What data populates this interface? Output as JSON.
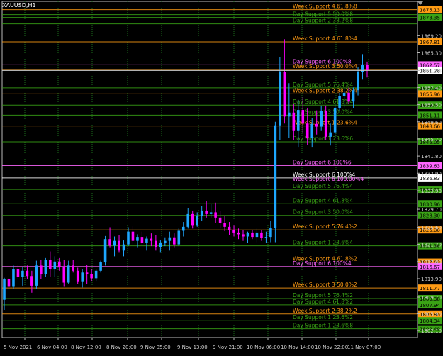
{
  "symbol_title": "XAUUSD,H1",
  "colors": {
    "bull": "#1ea7ff",
    "bear": "#ff00ff",
    "green_level": "#3aa315",
    "orange_level": "#ff9b14",
    "pink_level": "#ff66ff",
    "white_level": "#ffffff",
    "grid": "#1b6f1b"
  },
  "price_axis": {
    "min": 1800.5,
    "max": 1877.0,
    "ticks": [
      1869.2,
      1865.3,
      1861.28,
      1857.4,
      1853.5,
      1849.6,
      1845.7,
      1841.8,
      1837.9,
      1833.9,
      1829.7,
      1825.6,
      1821.7,
      1817.8,
      1813.9,
      1809.7,
      1805.9,
      1802.1
    ],
    "tick_labels": [
      "1869.20",
      "1865.30",
      "1861.28",
      "1857.40",
      "1853.50",
      "1849.60",
      "1845.70",
      "1841.80",
      "1837.90",
      "1833.90",
      "1829.70",
      "1825.60",
      "1821.70",
      "1817.80",
      "1813.90",
      "1809.70",
      "1805.90",
      "1802.10"
    ]
  },
  "time_axis": {
    "labels": [
      "5 Nov 2021",
      "6 Nov 04:00",
      "8 Nov 12:00",
      "8 Nov 20:00",
      "9 Nov 05:00",
      "9 Nov 13:00",
      "9 Nov 21:00",
      "10 Nov 06:00",
      "10 Nov 14:00",
      "10 Nov 22:00",
      "11 Nov 07:00"
    ]
  },
  "levels": [
    {
      "price": 1875.13,
      "label": "1875.13",
      "style": "orange",
      "text": "Week Support 4 61.8%8"
    },
    {
      "price": 1874.0,
      "label": "",
      "style": "green",
      "text": ""
    },
    {
      "price": 1873.35,
      "label": "1873.35",
      "style": "green",
      "text": "Day Support 5 50.0%8"
    },
    {
      "price": 1871.9,
      "label": "",
      "style": "green",
      "text": "Day Support 2 38.2%8"
    },
    {
      "price": 1867.81,
      "label": "1867.81",
      "style": "orange",
      "text": "Week Support 4 61.8%4"
    },
    {
      "price": 1862.57,
      "label": "1862.57",
      "style": "pink",
      "text": "Day Support 6 100%8"
    },
    {
      "price": 1861.5,
      "label": "",
      "style": "orange",
      "text": "Week Support 3 50.0%4"
    },
    {
      "price": 1857.34,
      "label": "1857.34",
      "style": "green",
      "text": "Day Support 5 76.4%4"
    },
    {
      "price": 1855.96,
      "label": "1855.96",
      "style": "orange",
      "text": "Week Support 2 38.2%4"
    },
    {
      "price": 1853.4,
      "label": "1853.4",
      "style": "green",
      "text": "Day Support 4 61.8%4"
    },
    {
      "price": 1851.11,
      "label": "1851.11",
      "style": "green",
      "text": "Day Support 3 50.0%4"
    },
    {
      "price": 1848.66,
      "label": "1848.66",
      "style": "orange",
      "text": "Week Support 1 23.6%4"
    },
    {
      "price": 1845.05,
      "label": "1845.05",
      "style": "green",
      "text": "Day Support 1 23.6%6"
    },
    {
      "price": 1839.63,
      "label": "1839.63",
      "style": "pink",
      "text": "Day Support 6 100%6"
    },
    {
      "price": 1836.83,
      "label": "1836.83",
      "style": "white",
      "text": "Week Support 6 100%4"
    },
    {
      "price": 1834.22,
      "label": "1834.22",
      "style": "green",
      "text": "Day Support 5 76.4%4"
    },
    {
      "price": 1830.96,
      "label": "1830.96",
      "style": "green",
      "text": "Day Support 4 61.8%4"
    },
    {
      "price": 1828.3,
      "label": "1828.30",
      "style": "green",
      "text": "Day Support 3 50.0%4"
    },
    {
      "price": 1825.0,
      "label": "1825.00",
      "style": "orange",
      "text": "Week Support 5 76.4%2"
    },
    {
      "price": 1821.38,
      "label": "1821.38",
      "style": "green",
      "text": "Day Support 1 23.6%4"
    },
    {
      "price": 1817.68,
      "label": "1817.68",
      "style": "orange",
      "text": "Week Support 4 61.8%2"
    },
    {
      "price": 1816.67,
      "label": "1816.67",
      "style": "pink",
      "text": "Day Support 6 100%4"
    },
    {
      "price": 1811.77,
      "label": "1811.77",
      "style": "orange",
      "text": "Week Support 3 50.0%2"
    },
    {
      "price": 1809.38,
      "label": "1809.38",
      "style": "green",
      "text": "Day Support 5 76.4%2"
    },
    {
      "price": 1807.94,
      "label": "1807.94",
      "style": "green",
      "text": "Day Support 4 61.8%2"
    },
    {
      "price": 1805.86,
      "label": "1805.86",
      "style": "orange",
      "text": "Week Support 2 38.2%2"
    },
    {
      "price": 1804.34,
      "label": "1804.34",
      "style": "green",
      "text": "Day Support 1 23.6%2"
    },
    {
      "price": 1802.49,
      "label": "1802.49",
      "style": "green",
      "text": "Day Support 1 23.6%8"
    }
  ],
  "current_price": {
    "price": 1861.28,
    "label": "1861.28"
  },
  "extra_label": "Week Support 6 100.00%4",
  "chart_data": {
    "type": "candlestick",
    "candles": [
      [
        1809.1,
        1814.1,
        1806.8,
        1813.9
      ],
      [
        1813.9,
        1814.8,
        1811.5,
        1812.2
      ],
      [
        1812.2,
        1816.9,
        1811.5,
        1816.0
      ],
      [
        1816.0,
        1817.1,
        1813.8,
        1814.3
      ],
      [
        1814.3,
        1816.6,
        1812.3,
        1815.7
      ],
      [
        1815.7,
        1816.9,
        1813.8,
        1814.5
      ],
      [
        1814.5,
        1815.7,
        1810.7,
        1812.3
      ],
      [
        1812.3,
        1818.0,
        1811.5,
        1816.9
      ],
      [
        1816.9,
        1818.2,
        1813.8,
        1814.9
      ],
      [
        1814.9,
        1818.6,
        1814.3,
        1818.2
      ],
      [
        1818.2,
        1820.1,
        1814.3,
        1816.1
      ],
      [
        1816.1,
        1819.0,
        1814.3,
        1817.8
      ],
      [
        1817.8,
        1818.6,
        1815.7,
        1816.5
      ],
      [
        1816.5,
        1818.2,
        1812.2,
        1813.0
      ],
      [
        1813.0,
        1818.0,
        1812.7,
        1816.9
      ],
      [
        1816.9,
        1818.2,
        1815.3,
        1815.7
      ],
      [
        1815.7,
        1816.4,
        1812.7,
        1813.3
      ],
      [
        1813.3,
        1816.1,
        1811.9,
        1815.3
      ],
      [
        1815.3,
        1817.1,
        1812.6,
        1814.9
      ],
      [
        1814.9,
        1816.1,
        1813.4,
        1814.0
      ],
      [
        1814.0,
        1816.1,
        1813.4,
        1815.7
      ],
      [
        1815.7,
        1818.0,
        1815.3,
        1817.6
      ],
      [
        1817.6,
        1823.6,
        1816.9,
        1822.9
      ],
      [
        1822.9,
        1825.6,
        1820.9,
        1821.4
      ],
      [
        1821.4,
        1823.5,
        1819.0,
        1822.5
      ],
      [
        1822.5,
        1823.8,
        1819.8,
        1820.3
      ],
      [
        1820.3,
        1822.6,
        1819.0,
        1821.7
      ],
      [
        1821.7,
        1825.6,
        1821.3,
        1824.6
      ],
      [
        1824.6,
        1825.8,
        1821.7,
        1822.5
      ],
      [
        1822.5,
        1824.0,
        1820.9,
        1823.4
      ],
      [
        1823.4,
        1824.6,
        1821.7,
        1822.1
      ],
      [
        1822.1,
        1823.5,
        1820.3,
        1823.0
      ],
      [
        1823.0,
        1824.2,
        1821.3,
        1822.5
      ],
      [
        1822.5,
        1823.8,
        1820.3,
        1821.0
      ],
      [
        1821.0,
        1822.6,
        1819.8,
        1822.1
      ],
      [
        1822.1,
        1823.3,
        1821.3,
        1822.5
      ],
      [
        1822.5,
        1824.6,
        1820.3,
        1823.3
      ],
      [
        1823.3,
        1824.2,
        1820.9,
        1821.7
      ],
      [
        1821.7,
        1825.3,
        1821.3,
        1824.8
      ],
      [
        1824.8,
        1826.8,
        1823.5,
        1825.7
      ],
      [
        1825.7,
        1830.0,
        1825.3,
        1828.6
      ],
      [
        1828.6,
        1829.4,
        1825.3,
        1826.1
      ],
      [
        1826.1,
        1829.0,
        1825.7,
        1828.2
      ],
      [
        1828.2,
        1830.5,
        1827.0,
        1829.4
      ],
      [
        1829.4,
        1831.6,
        1827.8,
        1828.6
      ],
      [
        1828.6,
        1830.9,
        1827.8,
        1829.0
      ],
      [
        1829.0,
        1831.2,
        1826.6,
        1827.8
      ],
      [
        1827.8,
        1829.4,
        1825.3,
        1826.5
      ],
      [
        1826.5,
        1828.2,
        1824.7,
        1825.7
      ],
      [
        1825.7,
        1826.8,
        1823.8,
        1825.0
      ],
      [
        1825.0,
        1826.1,
        1823.5,
        1824.4
      ],
      [
        1824.4,
        1825.3,
        1822.9,
        1824.0
      ],
      [
        1824.0,
        1825.0,
        1822.5,
        1823.5
      ],
      [
        1823.5,
        1824.6,
        1822.1,
        1824.4
      ],
      [
        1824.4,
        1825.0,
        1822.9,
        1823.4
      ],
      [
        1823.4,
        1825.3,
        1822.2,
        1824.4
      ],
      [
        1824.4,
        1825.0,
        1822.5,
        1823.1
      ],
      [
        1823.1,
        1824.6,
        1822.1,
        1823.4
      ],
      [
        1823.4,
        1827.0,
        1822.2,
        1825.5
      ],
      [
        1825.5,
        1849.6,
        1822.2,
        1848.8
      ],
      [
        1848.8,
        1864.4,
        1845.5,
        1860.9
      ],
      [
        1860.9,
        1868.4,
        1849.2,
        1850.8
      ],
      [
        1850.8,
        1858.4,
        1846.0,
        1851.7
      ],
      [
        1851.7,
        1853.7,
        1845.5,
        1847.5
      ],
      [
        1847.5,
        1854.6,
        1843.9,
        1852.3
      ],
      [
        1852.3,
        1855.2,
        1847.0,
        1849.2
      ],
      [
        1849.2,
        1852.8,
        1844.4,
        1846.0
      ],
      [
        1846.0,
        1850.4,
        1843.9,
        1849.1
      ],
      [
        1849.1,
        1852.2,
        1846.7,
        1848.5
      ],
      [
        1848.5,
        1853.3,
        1847.5,
        1852.1
      ],
      [
        1852.1,
        1853.3,
        1845.5,
        1846.2
      ],
      [
        1846.2,
        1849.2,
        1844.2,
        1847.2
      ],
      [
        1847.2,
        1853.6,
        1846.0,
        1852.8
      ],
      [
        1852.8,
        1856.2,
        1852.1,
        1855.5
      ],
      [
        1855.5,
        1857.4,
        1852.9,
        1856.2
      ],
      [
        1856.2,
        1857.4,
        1853.7,
        1854.2
      ],
      [
        1854.2,
        1857.4,
        1852.8,
        1856.8
      ],
      [
        1856.8,
        1862.1,
        1855.6,
        1861.0
      ],
      [
        1861.0,
        1865.0,
        1859.2,
        1862.5
      ],
      [
        1862.5,
        1863.3,
        1859.7,
        1861.3
      ]
    ]
  }
}
